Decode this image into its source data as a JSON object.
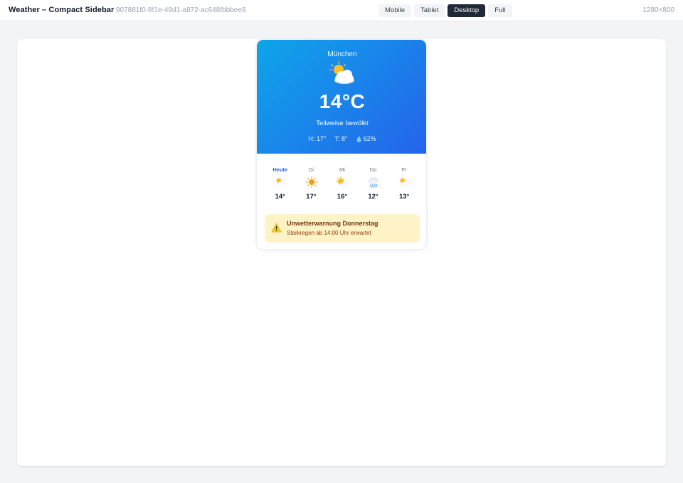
{
  "header": {
    "title": "Weather – Compact Sidebar",
    "id": "907881f0-8f1e-49d1-a872-ac648fbbbee9",
    "viewports": [
      "Mobile",
      "Tablet",
      "Desktop",
      "Full"
    ],
    "active_viewport": "Desktop",
    "size": "1280×800"
  },
  "weather": {
    "city": "München",
    "icon": "partly-cloudy-icon",
    "temperature": "14°C",
    "condition": "Teilweise bewölkt",
    "high": "H: 17°",
    "low": "T: 8°",
    "humidity": "62%",
    "accent": "#2563eb",
    "gradient_start": "#0ea5e9",
    "gradient_end": "#2563eb"
  },
  "forecast": [
    {
      "label": "Heute",
      "icon": "partly-cloudy-icon",
      "temp": "14°"
    },
    {
      "label": "Di",
      "icon": "sun-icon",
      "temp": "17°"
    },
    {
      "label": "Mi",
      "icon": "sun-behind-cloud-icon",
      "temp": "16°"
    },
    {
      "label": "Do",
      "icon": "rain-cloud-icon",
      "temp": "12°"
    },
    {
      "label": "Fr",
      "icon": "partly-cloudy-icon",
      "temp": "13°"
    }
  ],
  "alert": {
    "title": "Unwetterwarnung Donnerstag",
    "text": "Starkregen ab 14:00 Uhr erwartet",
    "color": "#fef3c7"
  }
}
